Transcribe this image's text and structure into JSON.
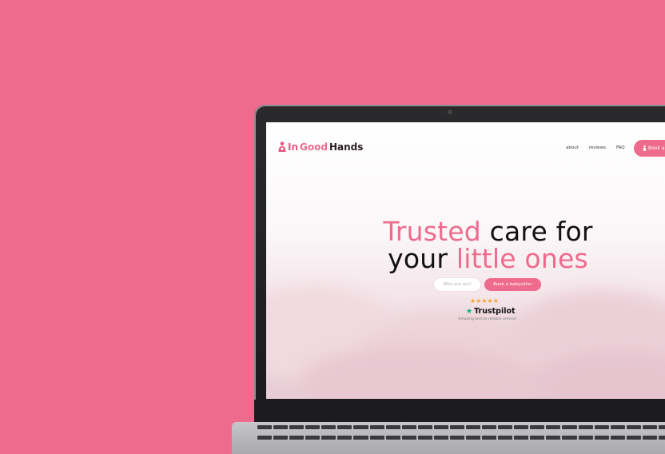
{
  "site": {
    "logo": {
      "in": "In",
      "good": "Good",
      "hands": "Hands"
    },
    "nav": {
      "links": [
        "about",
        "reviews",
        "FAQ"
      ],
      "cta": "Book a"
    },
    "hero": {
      "line1": {
        "pink": "Trusted",
        "dark": "care for"
      },
      "line2": {
        "dark": "your",
        "pink": "little ones"
      },
      "secondary_button": "Who are we?",
      "primary_button": "Book a babysitter",
      "stars": "★★★★★",
      "trustpilot": "Trustpilot",
      "trustpilot_note": "Amazing and so reliable service!"
    }
  },
  "colors": {
    "background": "#ee6b8d",
    "brand_pink": "#ee6b8d",
    "star": "#f3a42d",
    "trustpilot_green": "#00b67a"
  },
  "icons": {
    "logo": "mother-child-icon",
    "cta": "baby-icon",
    "trustpilot": "trustpilot-star-icon"
  }
}
